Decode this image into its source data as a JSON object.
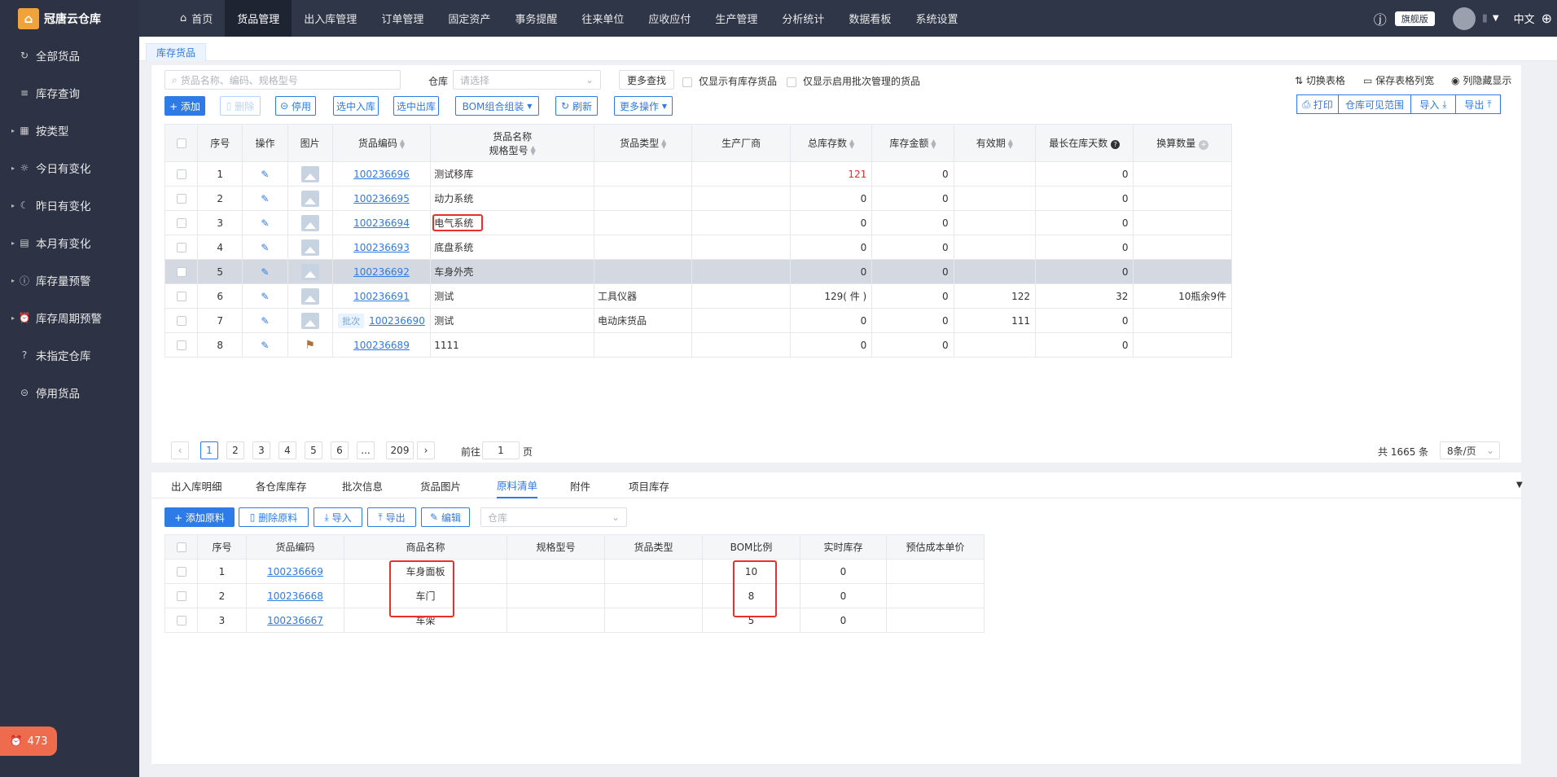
{
  "sidebar": {
    "logo_text": "冠唐云仓库",
    "items": [
      {
        "icon": "refresh-icon",
        "glyph": "↻",
        "label": "全部货品",
        "arrow": false
      },
      {
        "icon": "list-icon",
        "glyph": "≡",
        "label": "库存查询",
        "arrow": false
      },
      {
        "icon": "grid-icon",
        "glyph": "▦",
        "label": "按类型",
        "arrow": true
      },
      {
        "icon": "sun-icon",
        "glyph": "☼",
        "label": "今日有变化",
        "arrow": true
      },
      {
        "icon": "moon-icon",
        "glyph": "☾",
        "label": "昨日有变化",
        "arrow": true
      },
      {
        "icon": "calendar-icon",
        "glyph": "▤",
        "label": "本月有变化",
        "arrow": true
      },
      {
        "icon": "warning-icon",
        "glyph": "ⓘ",
        "label": "库存量预警",
        "arrow": true
      },
      {
        "icon": "alarm-clock-icon",
        "glyph": "⏰",
        "label": "库存周期预警",
        "arrow": true
      },
      {
        "icon": "question-icon",
        "glyph": "?",
        "label": "未指定仓库",
        "arrow": false
      },
      {
        "icon": "stop-icon",
        "glyph": "⊝",
        "label": "停用货品",
        "arrow": false
      }
    ],
    "alarm_count": "473"
  },
  "topnav": {
    "items": [
      "首页",
      "货品管理",
      "出入库管理",
      "订单管理",
      "固定资产",
      "事务提醒",
      "往来单位",
      "应收应付",
      "生产管理",
      "分析统计",
      "数据看板",
      "系统设置"
    ],
    "active_index": 1,
    "edition": "旗舰版",
    "language": "中文"
  },
  "page_tab": "库存货品",
  "filters": {
    "search_placeholder": "货品名称、编码、规格型号",
    "warehouse_label": "仓库",
    "warehouse_placeholder": "请选择",
    "more_search": "更多查找",
    "only_stock": "仅显示有库存货品",
    "only_batch": "仅显示启用批次管理的货品",
    "switch_table": "切换表格",
    "save_width": "保存表格列宽",
    "hidden_cols": "列隐藏显示"
  },
  "toolbar": {
    "add": "+ 添加",
    "delete": "删除",
    "disable": "停用",
    "select_in": "选中入库",
    "select_out": "选中出库",
    "bom": "BOM组合组装",
    "refresh": "刷新",
    "more_ops": "更多操作",
    "print": "打印",
    "warehouse_scope": "仓库可见范围",
    "import": "导入",
    "export": "导出"
  },
  "main_table": {
    "headers": [
      "序号",
      "操作",
      "图片",
      "货品编码",
      "货品名称",
      "规格型号",
      "货品类型",
      "生产厂商",
      "总库存数",
      "库存金额",
      "有效期",
      "最长在库天数",
      "换算数量"
    ],
    "rows": [
      {
        "no": "1",
        "code": "100236696",
        "name": "测试移库",
        "type": "",
        "maker": "",
        "stock": "121",
        "stock_red": true,
        "amount": "0",
        "expiry": "",
        "days": "0",
        "conv": "",
        "batch": "",
        "img": "placeholder"
      },
      {
        "no": "2",
        "code": "100236695",
        "name": "动力系统",
        "type": "",
        "maker": "",
        "stock": "0",
        "stock_red": false,
        "amount": "0",
        "expiry": "",
        "days": "0",
        "conv": "",
        "batch": "",
        "img": "placeholder"
      },
      {
        "no": "3",
        "code": "100236694",
        "name": "电气系统",
        "type": "",
        "maker": "",
        "stock": "0",
        "stock_red": false,
        "amount": "0",
        "expiry": "",
        "days": "0",
        "conv": "",
        "batch": "",
        "img": "placeholder"
      },
      {
        "no": "4",
        "code": "100236693",
        "name": "底盘系统",
        "type": "",
        "maker": "",
        "stock": "0",
        "stock_red": false,
        "amount": "0",
        "expiry": "",
        "days": "0",
        "conv": "",
        "batch": "",
        "img": "placeholder"
      },
      {
        "no": "5",
        "code": "100236692",
        "name": "车身外壳",
        "type": "",
        "maker": "",
        "stock": "0",
        "stock_red": false,
        "amount": "0",
        "expiry": "",
        "days": "0",
        "conv": "",
        "batch": "",
        "img": "placeholder",
        "selected": true
      },
      {
        "no": "6",
        "code": "100236691",
        "name": "测试",
        "type": "工具仪器",
        "maker": "",
        "stock": "129( 件 )",
        "stock_red": false,
        "amount": "0",
        "expiry": "122",
        "days": "32",
        "conv": "10瓶余9件",
        "batch": "",
        "img": "placeholder"
      },
      {
        "no": "7",
        "code": "100236690",
        "name": "测试",
        "type": "电动床货品",
        "maker": "",
        "stock": "0",
        "stock_red": false,
        "amount": "0",
        "expiry": "111",
        "days": "0",
        "conv": "",
        "batch": "批次",
        "img": "placeholder"
      },
      {
        "no": "8",
        "code": "100236689",
        "name": "1111",
        "type": "",
        "maker": "",
        "stock": "0",
        "stock_red": false,
        "amount": "0",
        "expiry": "",
        "days": "0",
        "conv": "",
        "batch": "",
        "img": "photo"
      }
    ]
  },
  "pagination": {
    "pages": [
      "1",
      "2",
      "3",
      "4",
      "5",
      "6",
      "...",
      "209"
    ],
    "goto_prefix": "前往",
    "goto_value": "1",
    "goto_suffix": "页",
    "total": "共 1665 条",
    "page_size": "8条/页"
  },
  "bottom_tabs": {
    "items": [
      "出入库明细",
      "各仓库库存",
      "批次信息",
      "货品图片",
      "原料清单",
      "附件",
      "项目库存"
    ],
    "active_index": 4
  },
  "bom_toolbar": {
    "add": "+ 添加原料",
    "delete": "删除原料",
    "import": "导入",
    "export": "导出",
    "edit": "编辑",
    "warehouse_placeholder": "仓库"
  },
  "bom_table": {
    "headers": [
      "序号",
      "货品编码",
      "商品名称",
      "规格型号",
      "货品类型",
      "BOM比例",
      "实时库存",
      "预估成本单价"
    ],
    "rows": [
      {
        "no": "1",
        "code": "100236669",
        "name": "车身面板",
        "spec": "",
        "type": "",
        "ratio": "10",
        "stock": "0",
        "cost": ""
      },
      {
        "no": "2",
        "code": "100236668",
        "name": "车门",
        "spec": "",
        "type": "",
        "ratio": "8",
        "stock": "0",
        "cost": ""
      },
      {
        "no": "3",
        "code": "100236667",
        "name": "车架",
        "spec": "",
        "type": "",
        "ratio": "5",
        "stock": "0",
        "cost": ""
      }
    ]
  },
  "colors": {
    "accent": "#2e7ae6",
    "sidebar": "#2d3345",
    "highlight": "#e8302a",
    "alarm": "#ee6b4d"
  }
}
